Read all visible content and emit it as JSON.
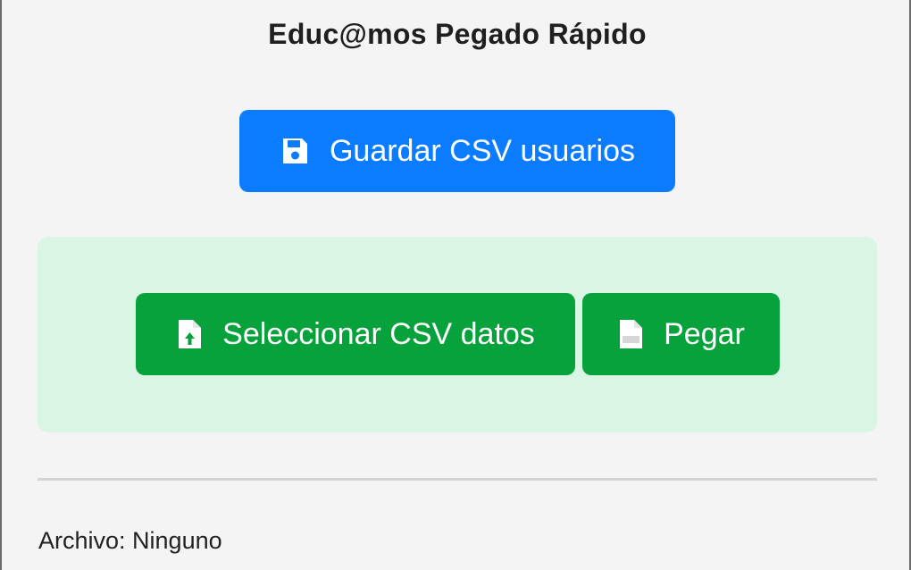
{
  "app": {
    "title": "Educ@mos Pegado Rápido"
  },
  "actions": {
    "save_label": "Guardar CSV usuarios",
    "save_icon": "save-icon",
    "select_label": "Seleccionar CSV datos",
    "select_icon": "file-upload-icon",
    "paste_label": "Pegar",
    "paste_icon": "csv-file-icon"
  },
  "status": {
    "file_label": "Archivo: Ninguno"
  },
  "colors": {
    "primary": "#0b7cff",
    "success": "#07a23c",
    "panel_bg": "#d9f5e4",
    "page_bg": "#f4f4f4"
  }
}
